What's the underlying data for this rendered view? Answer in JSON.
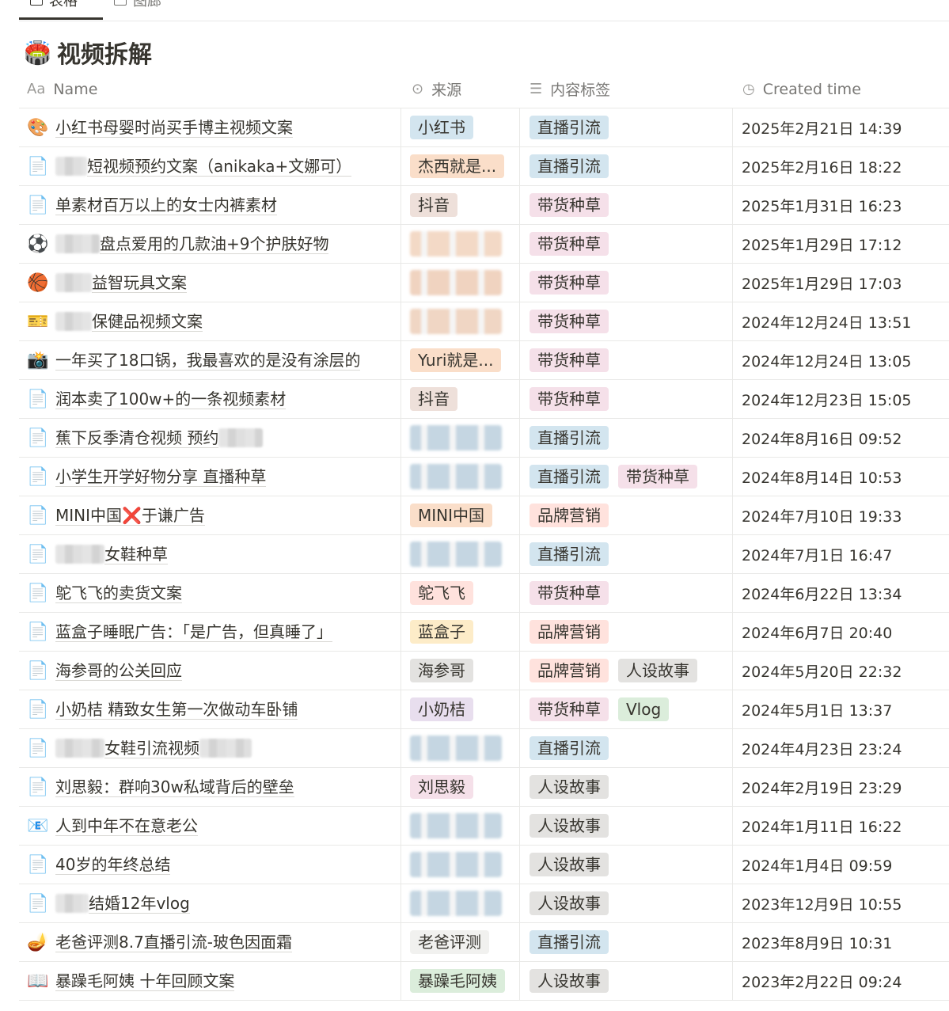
{
  "view_tabs": [
    {
      "label": "表格",
      "icon": "table-icon"
    },
    {
      "label": "图廊",
      "icon": "gallery-icon"
    }
  ],
  "database": {
    "title": "视频拆解",
    "icon": "stadium-icon"
  },
  "columns": {
    "name": {
      "label": "Name",
      "icon": "Aa"
    },
    "source": {
      "label": "来源",
      "icon": "select-icon"
    },
    "tags": {
      "label": "内容标签",
      "icon": "list-icon"
    },
    "created": {
      "label": "Created time",
      "icon": "clock-icon"
    }
  },
  "colors": {
    "blue": "#d3e5ef",
    "orange": "#fadec9",
    "brown": "#eee0da",
    "pink": "#f5e0e9",
    "red": "#ffe2dd",
    "yellow": "#fdecc8",
    "gray": "#e3e2e0",
    "purple": "#e8deee",
    "green": "#dbeddb",
    "light_gray": "#f1f1ef"
  },
  "rows": [
    {
      "icon": "🎨",
      "name": "小红书母婴时尚买手博主视频文案",
      "source": {
        "label": "小红书",
        "color": "#d3e5ef"
      },
      "tags": [
        {
          "label": "直播引流",
          "color": "#d3e5ef"
        }
      ],
      "created": "2025年2月21日 14:39"
    },
    {
      "icon": "📄",
      "name_prefix_blur": 40,
      "name": "短视频预约文案（anikaka+文娜可）",
      "source": {
        "label": "杰西就是...",
        "color": "#fadec9"
      },
      "tags": [
        {
          "label": "直播引流",
          "color": "#d3e5ef"
        }
      ],
      "created": "2025年2月16日 18:22"
    },
    {
      "icon": "📄",
      "name": "单素材百万以上的女士内裤素材",
      "source": {
        "label": "抖音",
        "color": "#eee0da"
      },
      "tags": [
        {
          "label": "带货种草",
          "color": "#f5e0e9"
        }
      ],
      "created": "2025年1月31日 16:23"
    },
    {
      "icon": "⚽",
      "name_prefix_blur": 56,
      "name": "盘点爱用的几款油+9个护肤好物",
      "source": {
        "blur": "#f3d9c6"
      },
      "tags": [
        {
          "label": "带货种草",
          "color": "#f5e0e9"
        }
      ],
      "created": "2025年1月29日 17:12"
    },
    {
      "icon": "🏀",
      "name_prefix_blur": 46,
      "name": "益智玩具文案",
      "source": {
        "blur": "#f0d3c0"
      },
      "tags": [
        {
          "label": "带货种草",
          "color": "#f5e0e9"
        }
      ],
      "created": "2025年1月29日 17:03"
    },
    {
      "icon": "🎫",
      "name_prefix_blur": 46,
      "name": "保健品视频文案",
      "source": {
        "blur": "#f0d6c4"
      },
      "tags": [
        {
          "label": "带货种草",
          "color": "#f5e0e9"
        }
      ],
      "created": "2024年12月24日 13:51"
    },
    {
      "icon": "📸",
      "name": "一年买了18口锅，我最喜欢的是没有涂层的",
      "source": {
        "label": "Yuri就是...",
        "color": "#fadec9"
      },
      "tags": [
        {
          "label": "带货种草",
          "color": "#f5e0e9"
        }
      ],
      "created": "2024年12月24日 13:05"
    },
    {
      "icon": "📄",
      "name": "润本卖了100w+的一条视频素材",
      "source": {
        "label": "抖音",
        "color": "#eee0da"
      },
      "tags": [
        {
          "label": "带货种草",
          "color": "#f5e0e9"
        }
      ],
      "created": "2024年12月23日 15:05"
    },
    {
      "icon": "📄",
      "name": "蕉下反季清仓视频 预约",
      "name_suffix_blur": 56,
      "source": {
        "blur": "#c5d6e2"
      },
      "tags": [
        {
          "label": "直播引流",
          "color": "#d3e5ef"
        }
      ],
      "created": "2024年8月16日 09:52"
    },
    {
      "icon": "📄",
      "name": "小学生开学好物分享 直播种草",
      "source": {
        "blur": "#c5d6e2"
      },
      "tags": [
        {
          "label": "直播引流",
          "color": "#d3e5ef"
        },
        {
          "label": "带货种草",
          "color": "#f5e0e9"
        }
      ],
      "created": "2024年8月14日 10:53"
    },
    {
      "icon": "📄",
      "name": "MINI中国❌于谦广告",
      "source": {
        "label": "MINI中国",
        "color": "#fadec9"
      },
      "tags": [
        {
          "label": "品牌营销",
          "color": "#ffe2dd"
        }
      ],
      "created": "2024年7月10日 19:33"
    },
    {
      "icon": "📄",
      "name_prefix_blur": 62,
      "name": "女鞋种草",
      "source": {
        "blur": "#c5d6e2"
      },
      "tags": [
        {
          "label": "直播引流",
          "color": "#d3e5ef"
        }
      ],
      "created": "2024年7月1日 16:47"
    },
    {
      "icon": "📄",
      "name": "鸵飞飞的卖货文案",
      "source": {
        "label": "鸵飞飞",
        "color": "#ffe2dd"
      },
      "tags": [
        {
          "label": "带货种草",
          "color": "#f5e0e9"
        }
      ],
      "created": "2024年6月22日 13:34"
    },
    {
      "icon": "📄",
      "name": "蓝盒子睡眠广告：「是广告，但真睡了」",
      "source": {
        "label": "蓝盒子",
        "color": "#fdecc8"
      },
      "tags": [
        {
          "label": "品牌营销",
          "color": "#ffe2dd"
        }
      ],
      "created": "2024年6月7日 20:40"
    },
    {
      "icon": "📄",
      "name": "海参哥的公关回应",
      "source": {
        "label": "海参哥",
        "color": "#e3e2e0"
      },
      "tags": [
        {
          "label": "品牌营销",
          "color": "#ffe2dd"
        },
        {
          "label": "人设故事",
          "color": "#e3e2e0"
        }
      ],
      "created": "2024年5月20日 22:32"
    },
    {
      "icon": "📄",
      "name": "小奶桔 精致女生第一次做动车卧铺",
      "source": {
        "label": "小奶桔",
        "color": "#e8deee"
      },
      "tags": [
        {
          "label": "带货种草",
          "color": "#f5e0e9"
        },
        {
          "label": "Vlog",
          "color": "#dbeddb"
        }
      ],
      "created": "2024年5月1日 13:37"
    },
    {
      "icon": "📄",
      "name_prefix_blur": 62,
      "name": "女鞋引流视频",
      "name_suffix_blur": 66,
      "source": {
        "blur": "#c5d6e2"
      },
      "tags": [
        {
          "label": "直播引流",
          "color": "#d3e5ef"
        }
      ],
      "created": "2024年4月23日 23:24"
    },
    {
      "icon": "📄",
      "name": "刘思毅：群响30w私域背后的壁垒",
      "source": {
        "label": "刘思毅",
        "color": "#f5e0e9"
      },
      "tags": [
        {
          "label": "人设故事",
          "color": "#e3e2e0"
        }
      ],
      "created": "2024年2月19日 23:29"
    },
    {
      "icon": "📧",
      "name": "人到中年不在意老公",
      "source": {
        "blur": "#c5d6e2"
      },
      "tags": [
        {
          "label": "人设故事",
          "color": "#e3e2e0"
        }
      ],
      "created": "2024年1月11日 16:22"
    },
    {
      "icon": "📄",
      "name": "40岁的年终总结",
      "source": {
        "blur": "#c5d6e2"
      },
      "tags": [
        {
          "label": "人设故事",
          "color": "#e3e2e0"
        }
      ],
      "created": "2024年1月4日 09:59"
    },
    {
      "icon": "📄",
      "name_prefix_blur": 42,
      "name": "结婚12年vlog",
      "source": {
        "blur": "#c5d6e2"
      },
      "tags": [
        {
          "label": "人设故事",
          "color": "#e3e2e0"
        }
      ],
      "created": "2023年12月9日 10:55"
    },
    {
      "icon": "🪔",
      "name": "老爸评测8.7直播引流-玻色因面霜",
      "source": {
        "label": "老爸评测",
        "color": "#f1f1ef"
      },
      "tags": [
        {
          "label": "直播引流",
          "color": "#d3e5ef"
        }
      ],
      "created": "2023年8月9日 10:31"
    },
    {
      "icon": "📖",
      "name": "暴躁毛阿姨 十年回顾文案",
      "source": {
        "label": "暴躁毛阿姨",
        "color": "#dbeddb"
      },
      "tags": [
        {
          "label": "人设故事",
          "color": "#e3e2e0"
        }
      ],
      "created": "2023年2月22日 09:24"
    }
  ]
}
